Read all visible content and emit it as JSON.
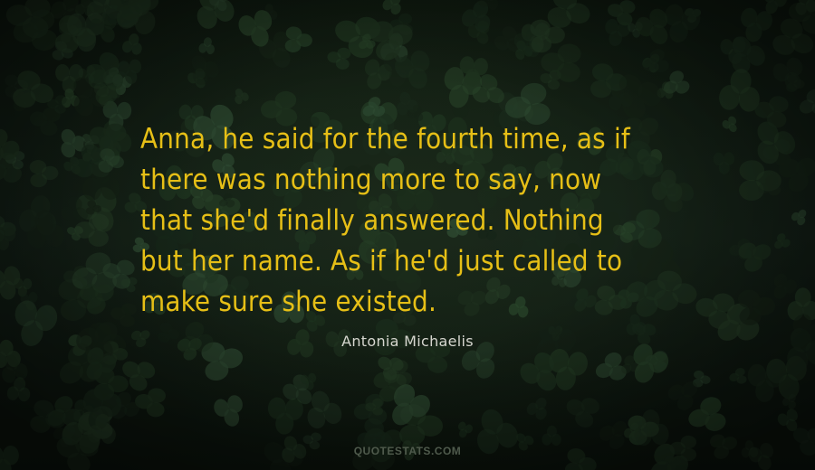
{
  "quote": {
    "lines": [
      "Anna, he said for the fourth time, as if",
      "there was nothing more to say, now",
      "that she'd finally answered. Nothing",
      "but her name. As if he'd just called to",
      "make sure she existed."
    ]
  },
  "author": "Antonia Michaelis",
  "watermark": "QUOTESTATS.COM",
  "colors": {
    "quote_text": "#e6bf16",
    "author_text": "#d6d6cf",
    "watermark_text": "#4f5a4c",
    "background": "#0f1a10"
  }
}
